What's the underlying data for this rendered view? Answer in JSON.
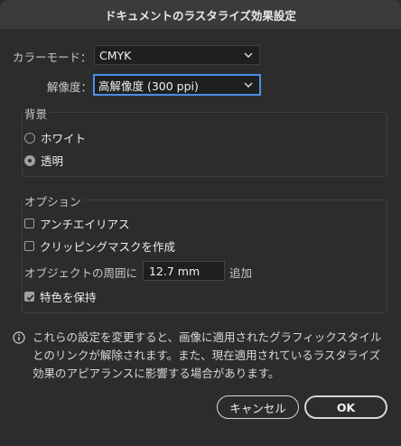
{
  "dialog": {
    "title": "ドキュメントのラスタライズ効果設定"
  },
  "color_mode": {
    "label": "カラーモード：",
    "value": "CMYK"
  },
  "resolution": {
    "label": "解像度：",
    "value": "高解像度 (300 ppi)"
  },
  "background": {
    "legend": "背景",
    "options": [
      {
        "label": "ホワイト",
        "selected": false
      },
      {
        "label": "透明",
        "selected": true
      }
    ]
  },
  "options": {
    "legend": "オプション",
    "antialias": {
      "label": "アンチエイリアス",
      "checked": false
    },
    "clipping_mask": {
      "label": "クリッピングマスクを作成",
      "checked": false
    },
    "surround": {
      "label": "オブジェクトの周囲に",
      "value": "12.7 mm",
      "suffix": "追加"
    },
    "preserve_spot": {
      "label": "特色を保持",
      "checked": true
    }
  },
  "info": {
    "text": "これらの設定を変更すると、画像に適用されたグラフィックスタイルとのリンクが解除されます。また、現在適用されているラスタライズ効果のアピアランスに影響する場合があります。"
  },
  "buttons": {
    "cancel": "キャンセル",
    "ok": "OK"
  }
}
